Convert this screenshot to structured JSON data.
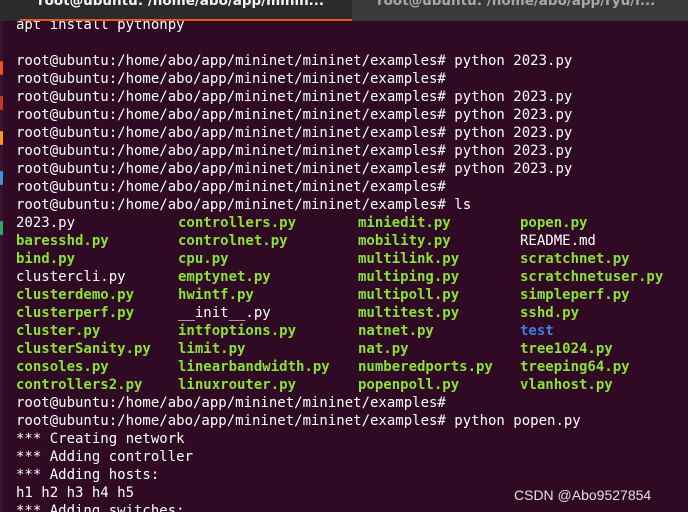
{
  "tabs": [
    {
      "title": "root@ubuntu: /home/abo/app/minin...",
      "active": true
    },
    {
      "title": "root@ubuntu: /home/abo/app/ryu/r...",
      "active": false
    }
  ],
  "colors": {
    "background": "#300a24",
    "text": "#ffffff",
    "executable": "#8ae234",
    "directory": "#3d7fe0",
    "tab_accent": "#e95420"
  },
  "terminal": {
    "lines_before_ls": [
      "apt install pythonpy",
      "",
      "root@ubuntu:/home/abo/app/mininet/mininet/examples# python 2023.py",
      "root@ubuntu:/home/abo/app/mininet/mininet/examples#",
      "root@ubuntu:/home/abo/app/mininet/mininet/examples# python 2023.py",
      "root@ubuntu:/home/abo/app/mininet/mininet/examples# python 2023.py",
      "root@ubuntu:/home/abo/app/mininet/mininet/examples# python 2023.py",
      "root@ubuntu:/home/abo/app/mininet/mininet/examples# python 2023.py",
      "root@ubuntu:/home/abo/app/mininet/mininet/examples# python 2023.py",
      "root@ubuntu:/home/abo/app/mininet/mininet/examples#",
      "root@ubuntu:/home/abo/app/mininet/mininet/examples# ls"
    ],
    "ls_rows": [
      [
        {
          "name": "2023.py",
          "kind": "plain"
        },
        {
          "name": "controllers.py",
          "kind": "script"
        },
        {
          "name": "miniedit.py",
          "kind": "script"
        },
        {
          "name": "popen.py",
          "kind": "script"
        }
      ],
      [
        {
          "name": "baresshd.py",
          "kind": "script"
        },
        {
          "name": "controlnet.py",
          "kind": "script"
        },
        {
          "name": "mobility.py",
          "kind": "script"
        },
        {
          "name": "README.md",
          "kind": "plain"
        }
      ],
      [
        {
          "name": "bind.py",
          "kind": "script"
        },
        {
          "name": "cpu.py",
          "kind": "script"
        },
        {
          "name": "multilink.py",
          "kind": "script"
        },
        {
          "name": "scratchnet.py",
          "kind": "script"
        }
      ],
      [
        {
          "name": "clustercli.py",
          "kind": "plain"
        },
        {
          "name": "emptynet.py",
          "kind": "script"
        },
        {
          "name": "multiping.py",
          "kind": "script"
        },
        {
          "name": "scratchnetuser.py",
          "kind": "script"
        }
      ],
      [
        {
          "name": "clusterdemo.py",
          "kind": "script"
        },
        {
          "name": "hwintf.py",
          "kind": "script"
        },
        {
          "name": "multipoll.py",
          "kind": "script"
        },
        {
          "name": "simpleperf.py",
          "kind": "script"
        }
      ],
      [
        {
          "name": "clusterperf.py",
          "kind": "script"
        },
        {
          "name": "__init__.py",
          "kind": "plain"
        },
        {
          "name": "multitest.py",
          "kind": "script"
        },
        {
          "name": "sshd.py",
          "kind": "script"
        }
      ],
      [
        {
          "name": "cluster.py",
          "kind": "script"
        },
        {
          "name": "intfoptions.py",
          "kind": "script"
        },
        {
          "name": "natnet.py",
          "kind": "script"
        },
        {
          "name": "test",
          "kind": "dir"
        }
      ],
      [
        {
          "name": "clusterSanity.py",
          "kind": "script"
        },
        {
          "name": "limit.py",
          "kind": "script"
        },
        {
          "name": "nat.py",
          "kind": "script"
        },
        {
          "name": "tree1024.py",
          "kind": "script"
        }
      ],
      [
        {
          "name": "consoles.py",
          "kind": "script"
        },
        {
          "name": "linearbandwidth.py",
          "kind": "script"
        },
        {
          "name": "numberedports.py",
          "kind": "script"
        },
        {
          "name": "treeping64.py",
          "kind": "script"
        }
      ],
      [
        {
          "name": "controllers2.py",
          "kind": "script"
        },
        {
          "name": "linuxrouter.py",
          "kind": "script"
        },
        {
          "name": "popenpoll.py",
          "kind": "script"
        },
        {
          "name": "vlanhost.py",
          "kind": "script"
        }
      ]
    ],
    "lines_after_ls": [
      "root@ubuntu:/home/abo/app/mininet/mininet/examples#",
      "root@ubuntu:/home/abo/app/mininet/mininet/examples# python popen.py",
      "*** Creating network",
      "*** Adding controller",
      "*** Adding hosts:",
      "h1 h2 h3 h4 h5",
      "*** Adding switches:"
    ]
  },
  "watermark": "CSDN @Abo9527854"
}
